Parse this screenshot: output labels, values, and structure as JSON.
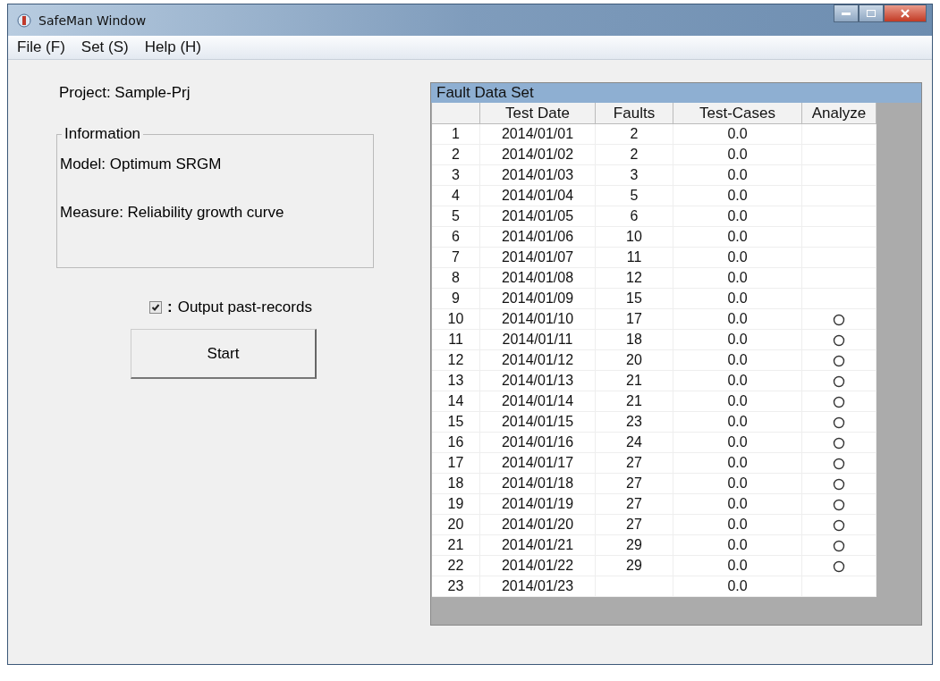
{
  "window": {
    "title": "SafeMan Window"
  },
  "menu": [
    "File (F)",
    "Set (S)",
    "Help (H)"
  ],
  "project": "Project: Sample-Prj",
  "information": {
    "legend": "Information",
    "model": "Model: Optimum SRGM",
    "measure": "Measure: Reliability growth curve"
  },
  "output_option": {
    "label": "Output past-records",
    "separator": ":",
    "checked": true
  },
  "start_button": "Start",
  "table": {
    "title": "Fault Data Set",
    "columns": [
      "Test Date",
      "Faults",
      "Test-Cases",
      "Analyze"
    ],
    "rows": [
      {
        "no": "1",
        "date": "2014/01/01",
        "faults": "2",
        "cases": "0.0",
        "analyze": false
      },
      {
        "no": "2",
        "date": "2014/01/02",
        "faults": "2",
        "cases": "0.0",
        "analyze": false
      },
      {
        "no": "3",
        "date": "2014/01/03",
        "faults": "3",
        "cases": "0.0",
        "analyze": false
      },
      {
        "no": "4",
        "date": "2014/01/04",
        "faults": "5",
        "cases": "0.0",
        "analyze": false
      },
      {
        "no": "5",
        "date": "2014/01/05",
        "faults": "6",
        "cases": "0.0",
        "analyze": false
      },
      {
        "no": "6",
        "date": "2014/01/06",
        "faults": "10",
        "cases": "0.0",
        "analyze": false
      },
      {
        "no": "7",
        "date": "2014/01/07",
        "faults": "11",
        "cases": "0.0",
        "analyze": false
      },
      {
        "no": "8",
        "date": "2014/01/08",
        "faults": "12",
        "cases": "0.0",
        "analyze": false
      },
      {
        "no": "9",
        "date": "2014/01/09",
        "faults": "15",
        "cases": "0.0",
        "analyze": false
      },
      {
        "no": "10",
        "date": "2014/01/10",
        "faults": "17",
        "cases": "0.0",
        "analyze": true
      },
      {
        "no": "11",
        "date": "2014/01/11",
        "faults": "18",
        "cases": "0.0",
        "analyze": true
      },
      {
        "no": "12",
        "date": "2014/01/12",
        "faults": "20",
        "cases": "0.0",
        "analyze": true
      },
      {
        "no": "13",
        "date": "2014/01/13",
        "faults": "21",
        "cases": "0.0",
        "analyze": true
      },
      {
        "no": "14",
        "date": "2014/01/14",
        "faults": "21",
        "cases": "0.0",
        "analyze": true
      },
      {
        "no": "15",
        "date": "2014/01/15",
        "faults": "23",
        "cases": "0.0",
        "analyze": true
      },
      {
        "no": "16",
        "date": "2014/01/16",
        "faults": "24",
        "cases": "0.0",
        "analyze": true
      },
      {
        "no": "17",
        "date": "2014/01/17",
        "faults": "27",
        "cases": "0.0",
        "analyze": true
      },
      {
        "no": "18",
        "date": "2014/01/18",
        "faults": "27",
        "cases": "0.0",
        "analyze": true
      },
      {
        "no": "19",
        "date": "2014/01/19",
        "faults": "27",
        "cases": "0.0",
        "analyze": true
      },
      {
        "no": "20",
        "date": "2014/01/20",
        "faults": "27",
        "cases": "0.0",
        "analyze": true
      },
      {
        "no": "21",
        "date": "2014/01/21",
        "faults": "29",
        "cases": "0.0",
        "analyze": true
      },
      {
        "no": "22",
        "date": "2014/01/22",
        "faults": "29",
        "cases": "0.0",
        "analyze": true
      },
      {
        "no": "23",
        "date": "2014/01/23",
        "cases": "0.0",
        "analyze": false
      }
    ]
  }
}
